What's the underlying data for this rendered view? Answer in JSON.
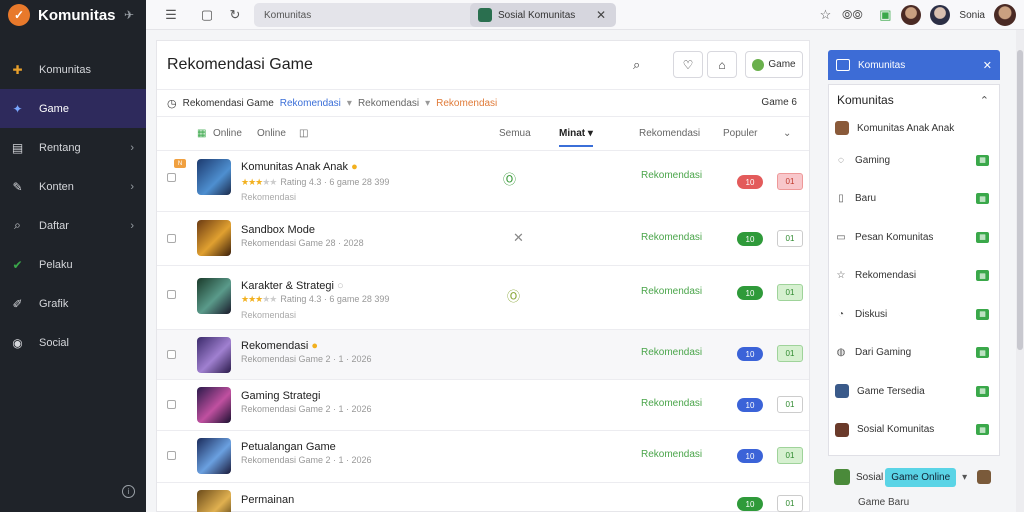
{
  "sidebar": {
    "brand": "Komunitas",
    "items": [
      {
        "label": "Komunitas",
        "icon": "puzzle-icon",
        "chev": ""
      },
      {
        "label": "Game",
        "icon": "gamepad-icon",
        "chev": "",
        "active": true
      },
      {
        "label": "Rentang",
        "icon": "doc-icon",
        "chev": "›"
      },
      {
        "label": "Konten",
        "icon": "paint-icon",
        "chev": "›"
      },
      {
        "label": "Daftar",
        "icon": "search-icon",
        "chev": "›"
      },
      {
        "label": "Pelaku",
        "icon": "check-icon",
        "chev": ""
      },
      {
        "label": "Grafik",
        "icon": "brush-icon",
        "chev": ""
      },
      {
        "label": "Social",
        "icon": "globe-icon",
        "chev": ""
      }
    ]
  },
  "topbar": {
    "search_text": "Komunitas",
    "active_tab": "Sosial Komunitas",
    "user_name": "Sonia"
  },
  "main": {
    "title": "Rekomendasi Game",
    "btn_label": "Game",
    "breadcrumb": [
      "Rekomendasi Game",
      "Rekomendasi",
      "Rekomendasi",
      "Rekomendasi"
    ],
    "crumb_right": "Game 6",
    "filters": {
      "online_label": "Online",
      "left_label": "Online",
      "tab1": "Semua",
      "tab_active": "Minat",
      "tab3": "Rekomendasi",
      "tab4": "Populer"
    },
    "rows": [
      {
        "title": "Komunitas Anak Anak",
        "sub": "Rating 4.3 · 6 game 28 399",
        "sub2": "Rekomendasi",
        "mid": "Ⓞ",
        "status": "Rekomendasi",
        "pill": "10",
        "pill_color": "red",
        "sq": "01",
        "sq_style": "pink",
        "stars": 3
      },
      {
        "title": "Sandbox Mode",
        "sub": "Rekomendasi Game 28 · 2028",
        "sub2": "",
        "mid": "✕",
        "status": "Rekomendasi",
        "pill": "10",
        "pill_color": "green",
        "sq": "01",
        "sq_style": "outline",
        "stars": 0
      },
      {
        "title": "Karakter & Strategi",
        "sub": "Rating 4.3 · 6 game 28 399",
        "sub2": "Rekomendasi",
        "mid": "Ⓞ",
        "status": "Rekomendasi",
        "pill": "10",
        "pill_color": "green",
        "sq": "01",
        "sq_style": "green",
        "stars": 3
      },
      {
        "title": "Rekomendasi",
        "sub": "Rekomendasi Game 2 · 1 · 2026",
        "sub2": "",
        "mid": "",
        "status": "Rekomendasi",
        "pill": "10",
        "pill_color": "blue",
        "sq": "01",
        "sq_style": "green",
        "stars": 0
      },
      {
        "title": "Gaming Strategi",
        "sub": "Rekomendasi Game 2 · 1 · 2026",
        "sub2": "",
        "mid": "",
        "status": "Rekomendasi",
        "pill": "10",
        "pill_color": "blue",
        "sq": "01",
        "sq_style": "outline",
        "stars": 0
      },
      {
        "title": "Petualangan Game",
        "sub": "Rekomendasi Game 2 · 1 · 2026",
        "sub2": "",
        "mid": "",
        "status": "Rekomendasi",
        "pill": "10",
        "pill_color": "blue",
        "sq": "01",
        "sq_style": "green",
        "stars": 0
      },
      {
        "title": "Permainan",
        "sub": "",
        "sub2": "",
        "mid": "",
        "status": "",
        "pill": "10",
        "pill_color": "green",
        "sq": "01",
        "sq_style": "outline",
        "stars": 0
      }
    ]
  },
  "rpanel": {
    "header": "Komunitas",
    "title": "Komunitas",
    "items": [
      {
        "label": "Komunitas Anak Anak",
        "kind": "avatar"
      },
      {
        "label": "Gaming",
        "kind": "icon"
      },
      {
        "label": "Baru",
        "kind": "icon"
      },
      {
        "label": "Pesan Komunitas",
        "kind": "icon"
      },
      {
        "label": "Rekomendasi",
        "kind": "icon"
      },
      {
        "label": "Diskusi",
        "kind": "icon"
      },
      {
        "label": "Dari Gaming",
        "kind": "icon"
      },
      {
        "label": "Game Tersedia",
        "kind": "avatar"
      },
      {
        "label": "Sosial Komunitas",
        "kind": "avatar"
      }
    ],
    "bottom_label": "Sosial Game",
    "bottom_highlight": "Game Online",
    "last_label": "Game Baru"
  },
  "colors": {
    "accent": "#3d6cd6",
    "sidebar_bg": "#1f2329",
    "active_nav": "#2e2a5c"
  }
}
